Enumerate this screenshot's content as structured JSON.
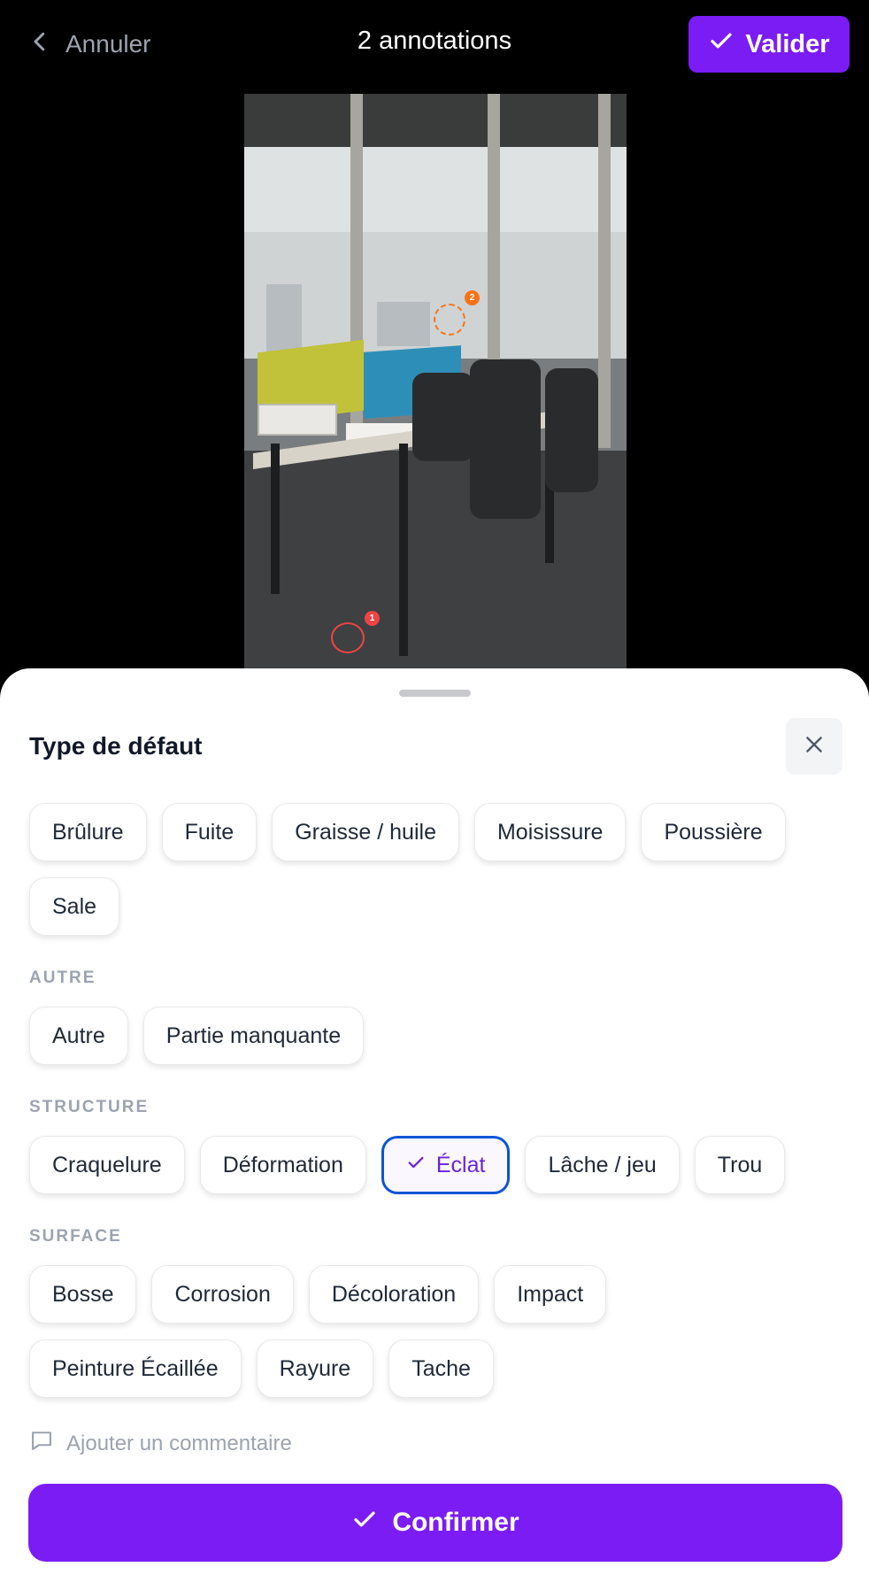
{
  "colors": {
    "accent": "#7b1cf5",
    "selected_border": "#0b55d6",
    "marker_1": "#ef4444",
    "marker_2": "#f97316"
  },
  "header": {
    "back_icon": "chevron-left-icon",
    "cancel_label": "Annuler",
    "title": "2 annotations",
    "validate_icon": "check-icon",
    "validate_label": "Valider"
  },
  "photo": {
    "markers": [
      {
        "number": "1",
        "style": "solid"
      },
      {
        "number": "2",
        "style": "dashed"
      }
    ]
  },
  "sheet": {
    "title": "Type de défaut",
    "close_icon": "close-icon",
    "ungrouped": [
      "Brûlure",
      "Fuite",
      "Graisse / huile",
      "Moisissure",
      "Poussière",
      "Sale"
    ],
    "sections": [
      {
        "label": "AUTRE",
        "chips": [
          "Autre",
          "Partie manquante"
        ]
      },
      {
        "label": "STRUCTURE",
        "chips": [
          "Craquelure",
          "Déformation",
          "Éclat",
          "Lâche / jeu",
          "Trou"
        ]
      },
      {
        "label": "SURFACE",
        "chips": [
          "Bosse",
          "Corrosion",
          "Décoloration",
          "Impact",
          "Peinture Écaillée",
          "Rayure",
          "Tache"
        ]
      }
    ],
    "selected_chip": "Éclat",
    "comment_icon": "comment-icon",
    "comment_placeholder": "Ajouter un commentaire",
    "confirm_icon": "check-icon",
    "confirm_label": "Confirmer"
  }
}
